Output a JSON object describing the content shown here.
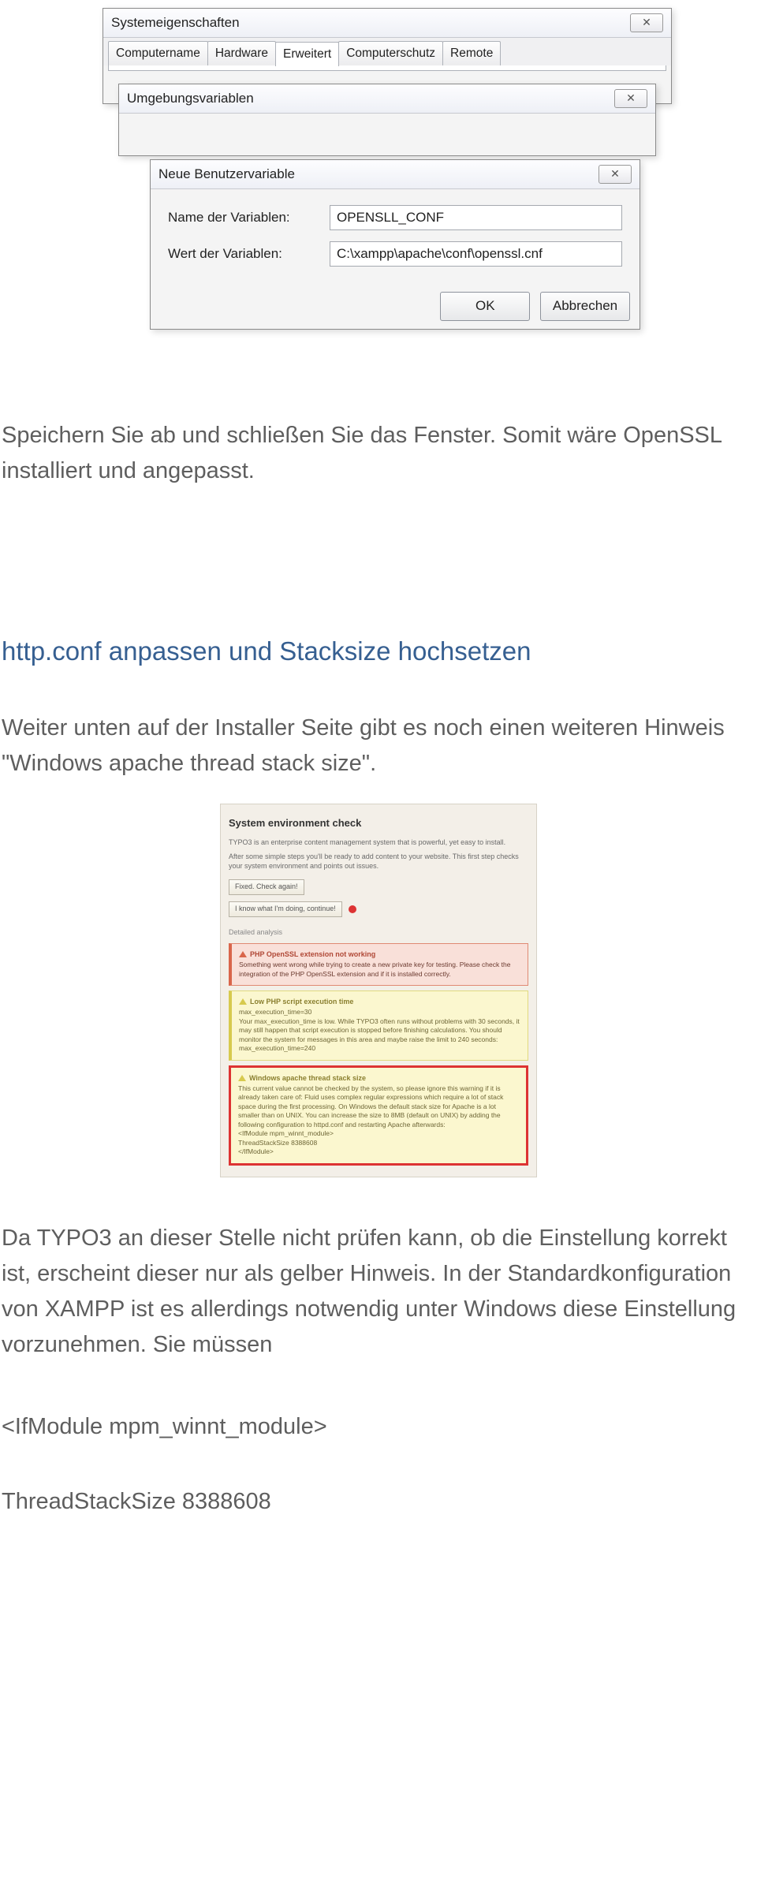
{
  "shot1": {
    "sys": {
      "title": "Systemeigenschaften",
      "tabs": [
        "Computername",
        "Hardware",
        "Erweitert",
        "Computerschutz",
        "Remote"
      ],
      "activeTab": 2
    },
    "env": {
      "title": "Umgebungsvariablen"
    },
    "newvar": {
      "title": "Neue Benutzervariable",
      "nameLabel": "Name der Variablen:",
      "nameVal": "OPENSLL_CONF",
      "valueLabel": "Wert der Variablen:",
      "valueVal": "C:\\xampp\\apache\\conf\\openssl.cnf",
      "ok": "OK",
      "cancel": "Abbrechen"
    }
  },
  "para1": "Speichern Sie ab und schließen Sie das Fenster. Somit wäre OpenSSL installiert und angepasst.",
  "h2": "http.conf anpassen und Stacksize  hochsetzen",
  "para2": "Weiter unten auf der Installer Seite gibt es noch einen weiteren Hinweis \"Windows apache thread stack size\".",
  "shot2": {
    "heading": "System environment check",
    "intro1": "TYPO3 is an enterprise content management system that is powerful, yet easy to install.",
    "intro2": "After some simple steps you'll be ready to add content to your website. This first step checks your system environment and points out issues.",
    "btnCheck": "Fixed. Check again!",
    "btnContinue": "I know what I'm doing, continue!",
    "detailed": "Detailed analysis",
    "alertRed": {
      "title": "PHP OpenSSL extension not working",
      "body": "Something went wrong while trying to create a new private key for testing. Please check the integration of the PHP OpenSSL extension and if it is installed correctly."
    },
    "alertYellow": {
      "title": "Low PHP script execution time",
      "body": "max_execution_time=30\nYour max_execution_time is low. While TYPO3 often runs without problems with 30 seconds, it may still happen that script execution is stopped before finishing calculations. You should monitor the system for messages in this area and maybe raise the limit to 240 seconds:\nmax_execution_time=240"
    },
    "alertBoxed": {
      "title": "Windows apache thread stack size",
      "body": "This current value cannot be checked by the system, so please ignore this warning if it is already taken care of: Fluid uses complex regular expressions which require a lot of stack space during the first processing. On Windows the default stack size for Apache is a lot smaller than on UNIX. You can increase the size to 8MB (default on UNIX) by adding the following configuration to httpd.conf and restarting Apache afterwards:\n<IfModule mpm_winnt_module>\nThreadStackSize 8388608\n</IfModule>"
    }
  },
  "para3": "Da TYPO3 an dieser Stelle nicht prüfen kann, ob die Einstellung korrekt ist, erscheint dieser nur als gelber Hinweis. In der Standardkonfiguration von XAMPP ist es allerdings notwendig unter Windows diese Einstellung vorzunehmen. Sie müssen",
  "codeLine1": "<IfModule mpm_winnt_module>",
  "codeLine2": "ThreadStackSize 8388608"
}
